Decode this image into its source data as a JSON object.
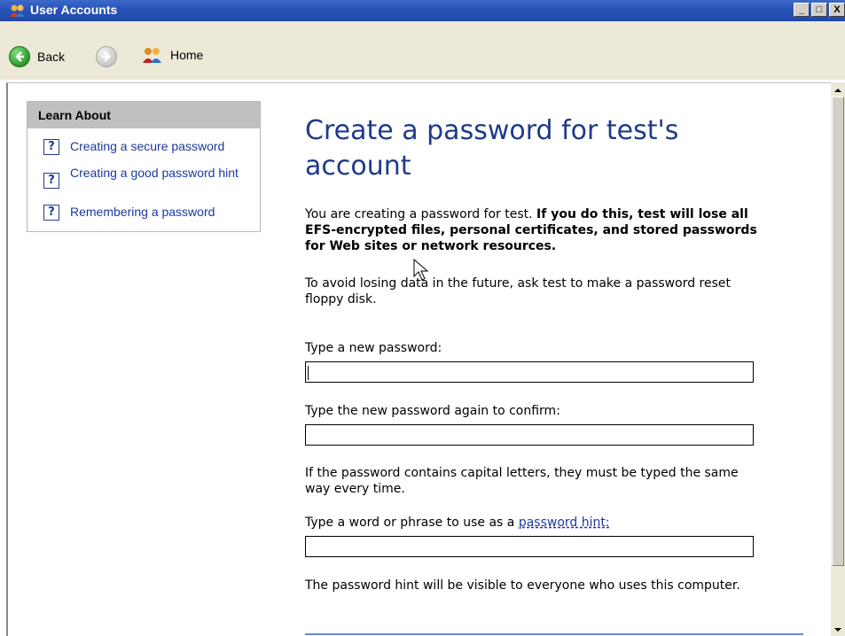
{
  "window": {
    "title": "User Accounts",
    "buttons": {
      "minimize": "_",
      "maximize": "□",
      "close": "X"
    }
  },
  "toolbar": {
    "back_label": "Back",
    "home_label": "Home",
    "icons": [
      "back-arrow-icon",
      "forward-arrow-icon",
      "home-users-icon"
    ]
  },
  "sidebar": {
    "header": "Learn About",
    "items": [
      {
        "label": "Creating a secure password"
      },
      {
        "label": "Creating a good password hint"
      },
      {
        "label": "Remembering a password"
      }
    ]
  },
  "main": {
    "title": "Create a password for test's account",
    "intro_plain": "You are creating a password for test. ",
    "intro_bold": "If you do this, test will lose all EFS-encrypted files, personal certificates, and stored passwords for Web sites or network resources.",
    "avoid_text": "To avoid losing data in the future, ask test to make a password reset floppy disk.",
    "new_password_label": "Type a new password:",
    "new_password_value": "",
    "confirm_label": "Type the new password again to confirm:",
    "confirm_value": "",
    "caps_note": "If the password contains capital letters, they must be typed the same way every time.",
    "hint_label_prefix": "Type a word or phrase to use as a ",
    "hint_link": "password hint:",
    "hint_value": "",
    "hint_visibility_note": "The password hint will be visible to everyone who uses this computer."
  },
  "colors": {
    "title_bar": "#2a55b8",
    "heading": "#1f3a8a",
    "link": "#1a3aa0",
    "toolbar_bg": "#ece9d8"
  }
}
